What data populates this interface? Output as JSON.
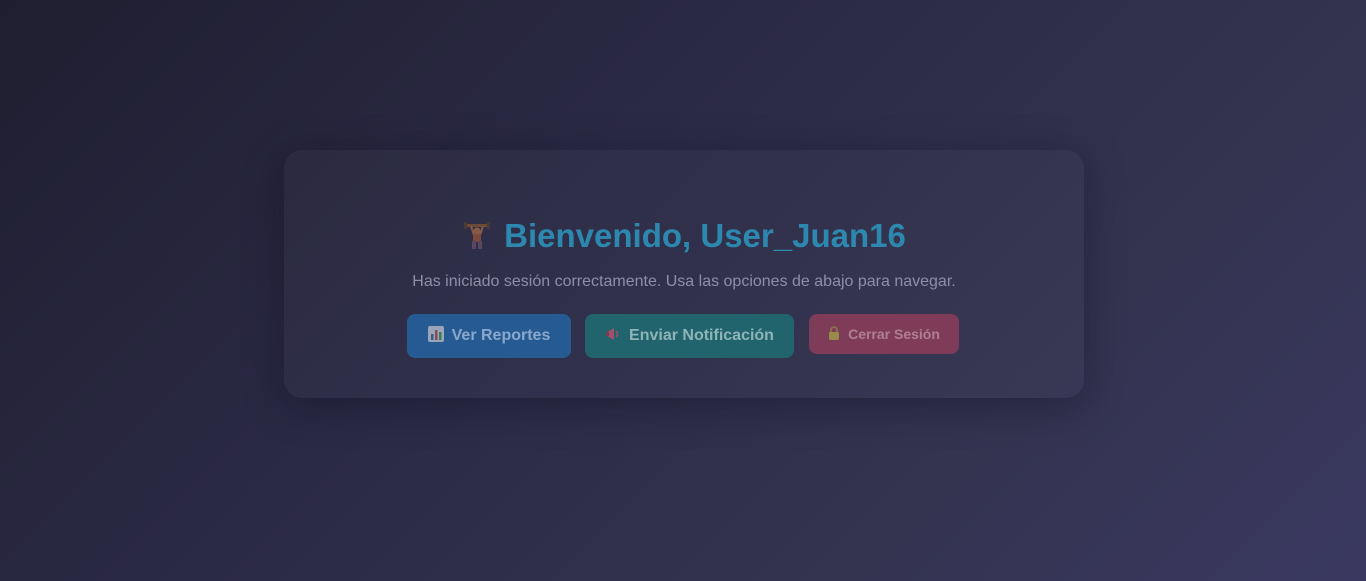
{
  "welcome": {
    "title": "Bienvenido, User_Juan16",
    "title_icon": "weightlifter-icon",
    "subtitle": "Has iniciado sesión correctamente. Usa las opciones de abajo para navegar."
  },
  "actions": {
    "reports": {
      "label": "Ver Reportes",
      "icon": "bar-chart-icon",
      "color": "#255a92"
    },
    "notify": {
      "label": "Enviar Notificación",
      "icon": "megaphone-icon",
      "color": "#22646e"
    },
    "logout": {
      "label": "Cerrar Sesión",
      "icon": "lock-icon",
      "color": "#7f3c58"
    }
  },
  "colors": {
    "heading": "#2d88b0",
    "text_muted": "#8e8ea6"
  }
}
